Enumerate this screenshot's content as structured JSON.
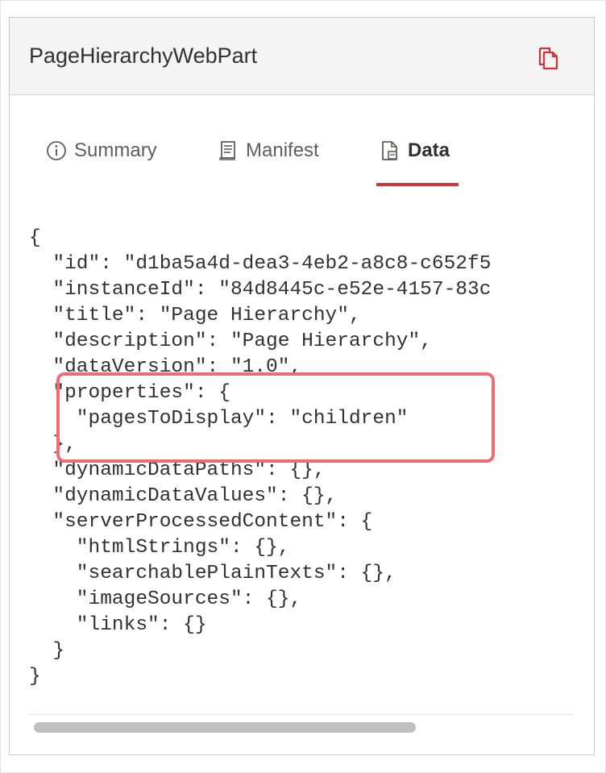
{
  "panel": {
    "title": "PageHierarchyWebPart",
    "copy_icon": "copy-icon"
  },
  "tabs": [
    {
      "label": "Summary",
      "icon": "info-icon",
      "active": false
    },
    {
      "label": "Manifest",
      "icon": "manifest-icon",
      "active": false
    },
    {
      "label": "Data",
      "icon": "data-file-icon",
      "active": true
    }
  ],
  "code": {
    "lines": [
      "{",
      "  \"id\": \"d1ba5a4d-dea3-4eb2-a8c8-c652f5",
      "  \"instanceId\": \"84d8445c-e52e-4157-83c",
      "  \"title\": \"Page Hierarchy\",",
      "  \"description\": \"Page Hierarchy\",",
      "  \"dataVersion\": \"1.0\",",
      "  \"properties\": {",
      "    \"pagesToDisplay\": \"children\"",
      "  },",
      "  \"dynamicDataPaths\": {},",
      "  \"dynamicDataValues\": {},",
      "  \"serverProcessedContent\": {",
      "    \"htmlStrings\": {},",
      "    \"searchablePlainTexts\": {},",
      "    \"imageSources\": {},",
      "    \"links\": {}",
      "  }",
      "}"
    ]
  },
  "colors": {
    "accent": "#d13438",
    "highlight_border": "#f16b73"
  }
}
